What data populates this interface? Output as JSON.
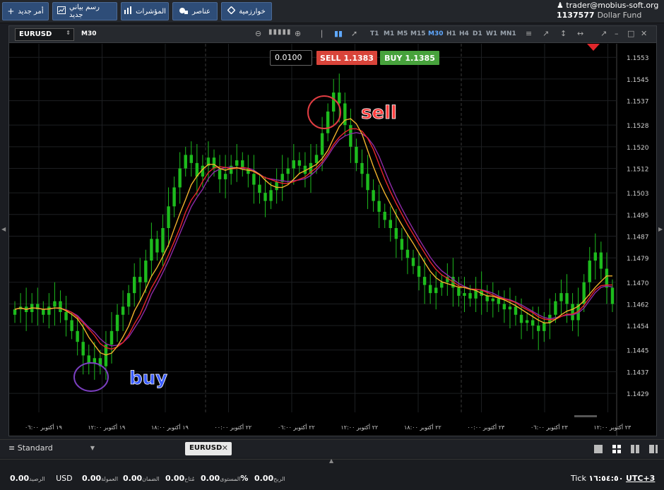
{
  "toolbar": {
    "buttons": [
      {
        "label": "أمر جديد",
        "icon": "+"
      },
      {
        "label": "رسم بياني جديد",
        "icon": "chart"
      },
      {
        "label": "المؤشرات",
        "icon": "bars"
      },
      {
        "label": "عناصر",
        "icon": "shapes"
      },
      {
        "label": "خوارزمية",
        "icon": "diamond"
      }
    ]
  },
  "account": {
    "user": "trader@mobius-soft.org",
    "balance_id": "1137577",
    "fund": "Dollar Fund"
  },
  "chart_toolbar": {
    "symbol": "EURUSD",
    "timeframe": "M30",
    "timeframes": [
      "T1",
      "M1",
      "M5",
      "M15",
      "M30",
      "H1",
      "H4",
      "D1",
      "W1",
      "MN1"
    ],
    "active_timeframe": "M30"
  },
  "trade": {
    "qty": "0.0100",
    "sell_label": "SELL",
    "sell_price": "1.1383",
    "buy_label": "BUY",
    "buy_price": "1.1385",
    "sell_color": "#d9443a",
    "buy_color": "#47a23c"
  },
  "annotations": {
    "sell_text": "sell",
    "buy_text": "buy"
  },
  "chart_data": {
    "type": "candlestick",
    "y_ticks": [
      1.1553,
      1.1545,
      1.1537,
      1.1528,
      1.152,
      1.1512,
      1.1503,
      1.1495,
      1.1487,
      1.1479,
      1.147,
      1.1462,
      1.1454,
      1.1445,
      1.1437,
      1.1429
    ],
    "ylim": [
      1.1422,
      1.1558
    ],
    "x_labels": [
      "١٩ أكتوبر ٠٦:٠٠",
      "١٩ أكتوبر ١٢:٠٠",
      "١٩ أكتوبر ١٨:٠٠",
      "٢٢ أكتوبر ٠٠:٠٠",
      "٢٢ أكتوبر ٠٦:٠٠",
      "٢٢ أكتوبر ١٢:٠٠",
      "٢٢ أكتوبر ١٨:٠٠",
      "٢٣ أكتوبر ٠٠:٠٠",
      "٢٣ أكتوبر ٠٦:٠٠",
      "٢٣ أكتوبر ١٢:٠٠"
    ],
    "close": [
      1.146,
      1.1461,
      1.1459,
      1.1462,
      1.146,
      1.1458,
      1.1461,
      1.1463,
      1.1459,
      1.1456,
      1.1452,
      1.1448,
      1.1443,
      1.144,
      1.1442,
      1.1439,
      1.1447,
      1.1452,
      1.1458,
      1.1461,
      1.1466,
      1.1472,
      1.147,
      1.1478,
      1.1486,
      1.1481,
      1.149,
      1.1498,
      1.1505,
      1.1512,
      1.1517,
      1.1514,
      1.1509,
      1.1513,
      1.1516,
      1.1512,
      1.1508,
      1.151,
      1.1513,
      1.1515,
      1.1512,
      1.151,
      1.1506,
      1.1503,
      1.15,
      1.1504,
      1.1507,
      1.151,
      1.1512,
      1.1515,
      1.1513,
      1.151,
      1.1514,
      1.1517,
      1.1525,
      1.1533,
      1.154,
      1.1536,
      1.1528,
      1.152,
      1.1514,
      1.151,
      1.1504,
      1.15,
      1.1496,
      1.1493,
      1.149,
      1.1486,
      1.1482,
      1.1479,
      1.1476,
      1.1472,
      1.1469,
      1.1466,
      1.1468,
      1.147,
      1.1472,
      1.1468,
      1.1465,
      1.1466,
      1.1464,
      1.1467,
      1.1465,
      1.1463,
      1.1464,
      1.1462,
      1.146,
      1.1461,
      1.1458,
      1.1455,
      1.1456,
      1.1454,
      1.1452,
      1.1455,
      1.1458,
      1.1463,
      1.1466,
      1.1462,
      1.1456,
      1.1462,
      1.147,
      1.1478,
      1.1481,
      1.1475,
      1.1468,
      1.1462
    ]
  },
  "tabs": {
    "layout": "Standard",
    "chart_tab": "EURUSD"
  },
  "status": {
    "balance_label": "الرصيد",
    "balance": "0.00",
    "currency": "USD",
    "commission_label": "العمولة",
    "commission": "0.00",
    "margin_label": "الضمان",
    "margin": "0.00",
    "available_label": "مُتاح",
    "available": "0.00",
    "level_label": "المستوى",
    "level": "0.00",
    "level_unit": "%",
    "profit_label": "الربح",
    "profit": "0.00",
    "tick_label": "Tick",
    "time": "١٦:٥٤:٥٠",
    "timezone": "UTC+3"
  }
}
